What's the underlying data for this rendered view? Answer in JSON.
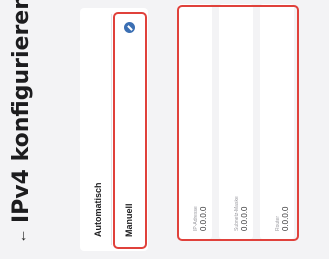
{
  "header": {
    "back_icon": "arrow-left-icon",
    "title": "IPv4 konfigurieren"
  },
  "modes": [
    {
      "label": "Automatisch",
      "selected": false
    },
    {
      "label": "Manuell",
      "selected": true
    }
  ],
  "fields": [
    {
      "label": "IP-Adresse",
      "value": "0.0.0.0"
    },
    {
      "label": "Subnetz-Maske",
      "value": "0.0.0.0"
    },
    {
      "label": "Router",
      "value": "0.0.0.0"
    }
  ],
  "colors": {
    "accent": "#3b6fb3",
    "highlight": "#e0413b",
    "background": "#f3f3f5"
  }
}
